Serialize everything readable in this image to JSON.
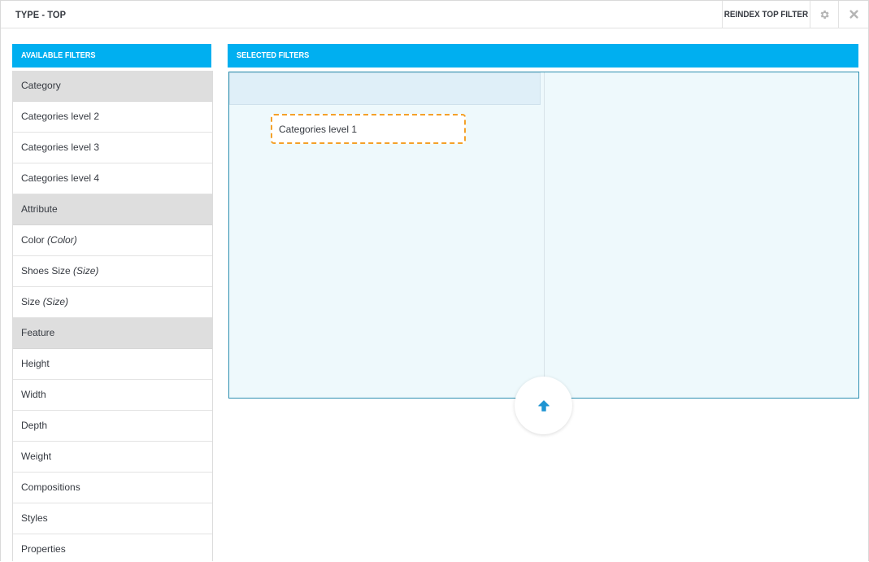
{
  "window": {
    "title": "TYPE - TOP",
    "reindex_label": "REINDEX TOP FILTER"
  },
  "available": {
    "title": "AVAILABLE FILTERS",
    "items": [
      {
        "label": "Category",
        "suffix": "",
        "type": "group"
      },
      {
        "label": "Categories level 2",
        "suffix": "",
        "type": "item"
      },
      {
        "label": "Categories level 3",
        "suffix": "",
        "type": "item"
      },
      {
        "label": "Categories level 4",
        "suffix": "",
        "type": "item"
      },
      {
        "label": "Attribute",
        "suffix": "",
        "type": "group"
      },
      {
        "label": "Color",
        "suffix": "(Color)",
        "type": "item"
      },
      {
        "label": "Shoes Size",
        "suffix": "(Size)",
        "type": "item"
      },
      {
        "label": "Size",
        "suffix": "(Size)",
        "type": "item"
      },
      {
        "label": "Feature",
        "suffix": "",
        "type": "group"
      },
      {
        "label": "Height",
        "suffix": "",
        "type": "item"
      },
      {
        "label": "Width",
        "suffix": "",
        "type": "item"
      },
      {
        "label": "Depth",
        "suffix": "",
        "type": "item"
      },
      {
        "label": "Weight",
        "suffix": "",
        "type": "item"
      },
      {
        "label": "Compositions",
        "suffix": "",
        "type": "item"
      },
      {
        "label": "Styles",
        "suffix": "",
        "type": "item"
      },
      {
        "label": "Properties",
        "suffix": "",
        "type": "item"
      }
    ]
  },
  "selected": {
    "title": "SELECTED FILTERS",
    "dragged_item": "Categories level 1"
  },
  "colors": {
    "accent": "#00aff0",
    "group_bg": "#dedede",
    "drop_bg": "#eef9fc",
    "dashed_border": "#f4a12a",
    "up_arrow": "#1e94d2"
  },
  "icons": {
    "settings": "gear-icon",
    "close": "close-icon",
    "move_up": "arrow-up-icon"
  }
}
